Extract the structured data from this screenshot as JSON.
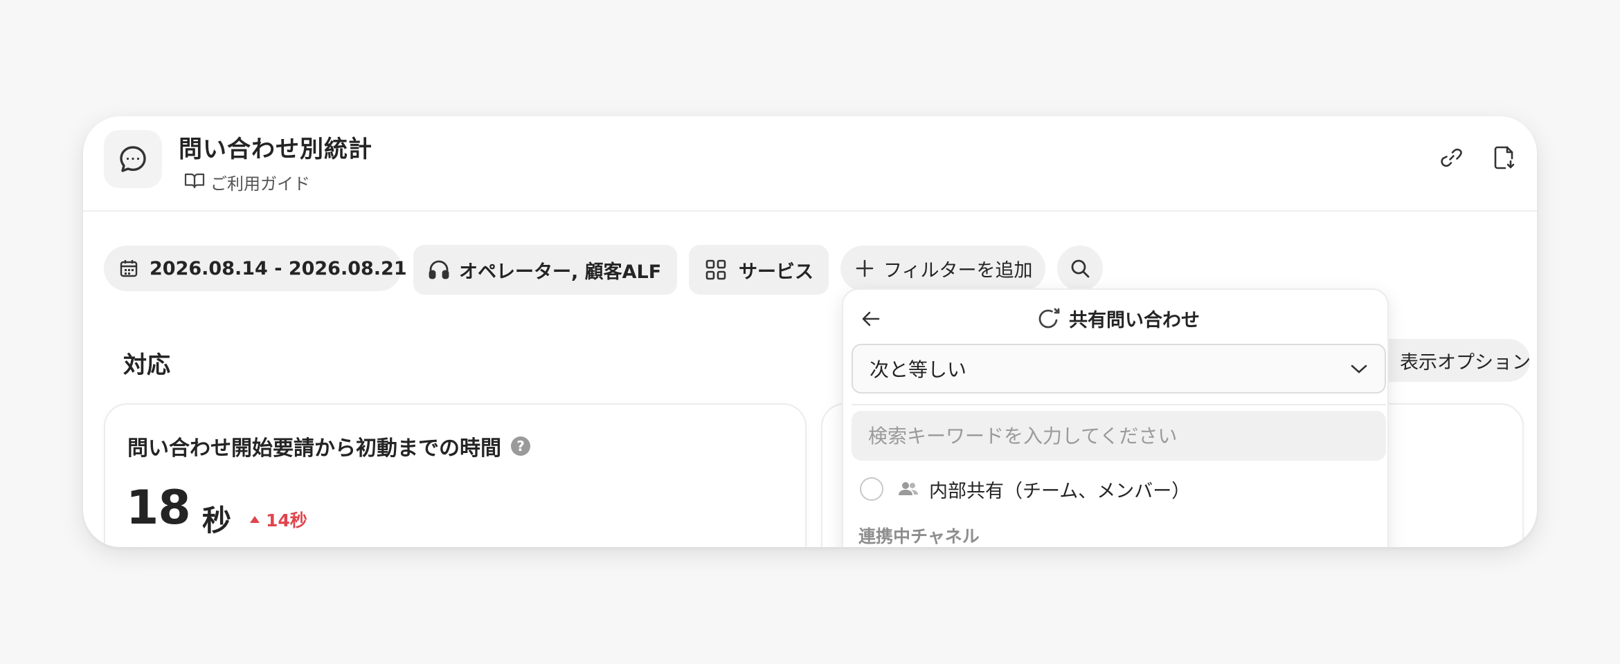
{
  "header": {
    "title": "問い合わせ別統計",
    "guide_label": "ご利用ガイド",
    "icons": {
      "app": "chat-bubble-icon",
      "guide": "book-icon",
      "link": "link-icon",
      "export": "file-download-icon"
    }
  },
  "filters": {
    "date_range": "2026.08.14 - 2026.08.21",
    "operator": "オペレーター, 顧客ALF",
    "service": "サービス",
    "add_filter": "フィルターを追加"
  },
  "section": {
    "title": "対応",
    "display_options": "表示オプション"
  },
  "metric": {
    "title": "問い合わせ開始要請から初動までの時間",
    "help": "?",
    "value": "18",
    "unit": "秒",
    "delta": "14秒",
    "delta_color": "#e0444e"
  },
  "dropdown": {
    "title": "共有問い合わせ",
    "condition": "次と等しい",
    "search_placeholder": "検索キーワードを入力してください",
    "option_label": "内部共有（チーム、メンバー）",
    "group_label": "連携中チャネル"
  }
}
